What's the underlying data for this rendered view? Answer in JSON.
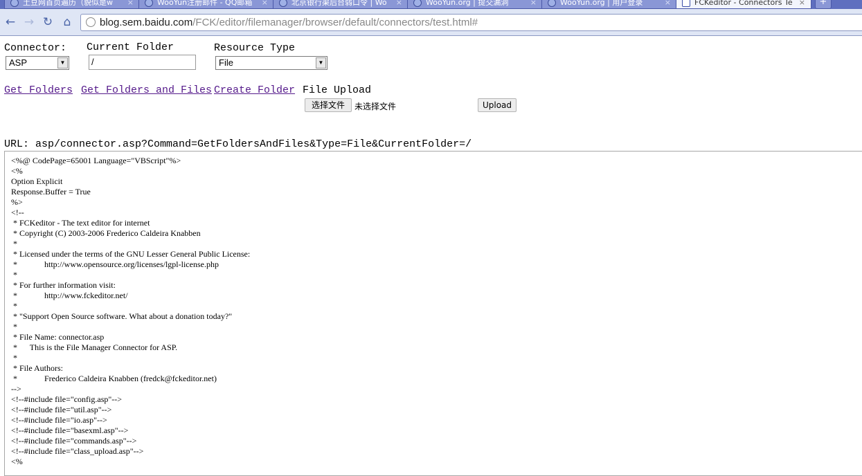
{
  "browser": {
    "tabs": [
      {
        "label": "土豆网首页遍历（貌似是w",
        "active": false
      },
      {
        "label": "WooYun注册邮件 - QQ邮箱",
        "active": false
      },
      {
        "label": "北京银行渠后台弱口令 | Wo",
        "active": false
      },
      {
        "label": "WooYun.org | 提交漏洞",
        "active": false
      },
      {
        "label": "WooYun.org | 用户登录",
        "active": false
      },
      {
        "label": "FCKeditor - Connectors Te",
        "active": true
      }
    ],
    "close_glyph": "×",
    "new_tab_glyph": "+",
    "url_host": "blog.sem.baidu.com",
    "url_path": "/FCK/editor/filemanager/browser/default/connectors/test.html#",
    "icons": [
      "back-icon",
      "forward-icon",
      "reload-icon",
      "home-icon",
      "globe-icon"
    ]
  },
  "form": {
    "connector_label": "Connector:",
    "connector_value": "ASP",
    "current_folder_label": "Current Folder",
    "current_folder_value": "/",
    "resource_type_label": "Resource Type",
    "resource_type_value": "File"
  },
  "actions": {
    "get_folders": "Get Folders",
    "get_folders_and_files": "Get Folders and Files",
    "create_folder": "Create Folder",
    "file_upload_label": "File Upload",
    "choose_file_button": "选择文件",
    "no_file_text": "未选择文件",
    "upload_button": "Upload"
  },
  "url_line": "URL: asp/connector.asp?Command=GetFoldersAndFiles&Type=File&CurrentFolder=/",
  "code_lines": [
    "<%@ CodePage=65001 Language=\"VBScript\"%>",
    "<%",
    "Option Explicit",
    "Response.Buffer = True",
    "%>",
    "<!--",
    " * FCKeditor - The text editor for internet",
    " * Copyright (C) 2003-2006 Frederico Caldeira Knabben",
    " *",
    " * Licensed under the terms of the GNU Lesser General Public License:",
    " *             http://www.opensource.org/licenses/lgpl-license.php",
    " *",
    " * For further information visit:",
    " *             http://www.fckeditor.net/",
    " *",
    " * \"Support Open Source software. What about a donation today?\"",
    " *",
    " * File Name: connector.asp",
    " *      This is the File Manager Connector for ASP.",
    " *",
    " * File Authors:",
    " *             Frederico Caldeira Knabben (fredck@fckeditor.net)",
    "-->",
    "<!--#include file=\"config.asp\"-->",
    "<!--#include file=\"util.asp\"-->",
    "<!--#include file=\"io.asp\"-->",
    "<!--#include file=\"basexml.asp\"-->",
    "<!--#include file=\"commands.asp\"-->",
    "<!--#include file=\"class_upload.asp\"-->",
    "<%"
  ]
}
